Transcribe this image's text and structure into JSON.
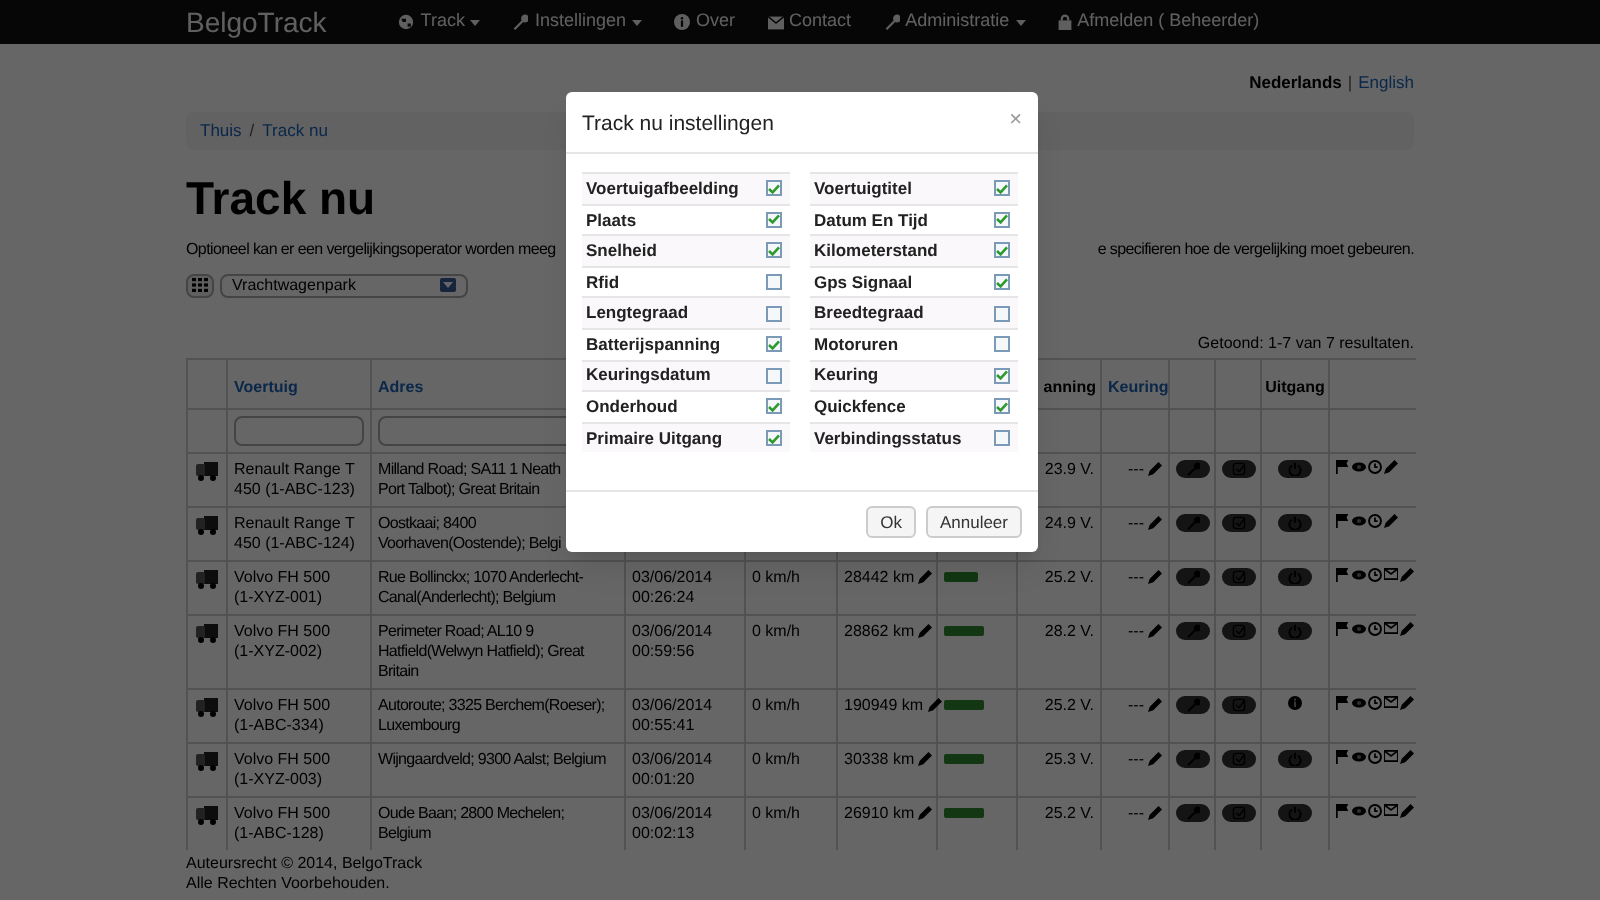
{
  "navbar": {
    "brand": "BelgoTrack",
    "items": [
      {
        "label": "Track",
        "dropdown": true
      },
      {
        "label": "Instellingen",
        "dropdown": true
      },
      {
        "label": "Over",
        "dropdown": false
      },
      {
        "label": "Contact",
        "dropdown": false
      },
      {
        "label": "Administratie",
        "dropdown": true
      },
      {
        "label": "Afmelden ( Beheerder)",
        "dropdown": false
      }
    ]
  },
  "languages": [
    {
      "label": "Nederlands",
      "selected": true
    },
    {
      "label": "English",
      "selected": false
    }
  ],
  "language_separator": "|",
  "breadcrumb": [
    "Thuis",
    "Track nu"
  ],
  "breadcrumb_separator": "/",
  "title": "Track nu",
  "intro": [
    "Optioneel kan er een vergelijkingsoperator worden meeg",
    "e specifieren hoe de vergelijking moet gebeuren."
  ],
  "fleet_select": {
    "value": "Vrachtwagenpark"
  },
  "summary": "Getoond: 1-7 van 7 resultaten.",
  "columns": {
    "vehicle": {
      "label": "Voertuig",
      "link": true
    },
    "address": {
      "label": "Adres",
      "link": true
    },
    "voltage": {
      "label": "anning",
      "link": false
    },
    "inspection": {
      "label": "Keuring",
      "link": true
    },
    "output": {
      "label": "Uitgang",
      "link": false
    }
  },
  "rows": [
    {
      "vehicle": "Renault Range T\n450 (1-ABC-123)",
      "address": "Milland Road; SA11 1 Neath\nPort Talbot); Great Britain",
      "voltage": "23.9 V.",
      "inspection": "---",
      "kind": "power",
      "mail": false
    },
    {
      "vehicle": "Renault Range T\n450 (1-ABC-124)",
      "address": "Oostkaai; 8400\nVoorhaven(Oostende); Belgi",
      "voltage": "24.9 V.",
      "inspection": "---",
      "kind": "power",
      "mail": false
    },
    {
      "vehicle": "Volvo FH 500\n(1-XYZ-001)",
      "address": "Rue Bollinckx; 1070 Anderlecht-\nCanal(Anderlecht); Belgium",
      "date": "03/06/2014\n00:26:24",
      "speed": "0 km/h",
      "odometer": "28442 km",
      "level": 0.5,
      "voltage": "25.2 V.",
      "inspection": "---",
      "kind": "power",
      "mail": true
    },
    {
      "vehicle": "Volvo FH 500\n(1-XYZ-002)",
      "address": "Perimeter Road; AL10 9\nHatfield(Welwyn Hatfield); Great\nBritain",
      "date": "03/06/2014\n00:59:56",
      "speed": "0 km/h",
      "odometer": "28862 km",
      "level": 0.58,
      "voltage": "28.2 V.",
      "inspection": "---",
      "kind": "power",
      "mail": true
    },
    {
      "vehicle": "Volvo FH 500\n(1-ABC-334)",
      "address": "Autoroute; 3325 Berchem(Roeser);\nLuxembourg",
      "date": "03/06/2014\n00:55:41",
      "speed": "0 km/h",
      "odometer": "190949 km",
      "level": 0.58,
      "voltage": "25.2 V.",
      "inspection": "---",
      "kind": "info",
      "mail": true
    },
    {
      "vehicle": "Volvo FH 500\n(1-XYZ-003)",
      "address": "Wijngaardveld; 9300 Aalst; Belgium",
      "date": "03/06/2014\n00:01:20",
      "speed": "0 km/h",
      "odometer": "30338 km",
      "level": 0.58,
      "voltage": "25.3 V.",
      "inspection": "---",
      "kind": "power",
      "mail": true
    },
    {
      "vehicle": "Volvo FH 500\n(1-ABC-128)",
      "address": "Oude Baan; 2800 Mechelen;\nBelgium",
      "date": "03/06/2014\n00:02:13",
      "speed": "0 km/h",
      "odometer": "26910 km",
      "level": 0.58,
      "voltage": "25.2 V.",
      "inspection": "---",
      "kind": "power",
      "mail": true
    }
  ],
  "footer": [
    "Auteursrecht © 2014, BelgoTrack",
    "Alle Rechten Voorbehouden."
  ],
  "modal": {
    "title": "Track nu instellingen",
    "close": "×",
    "left": [
      {
        "label": "Voertuigafbeelding",
        "checked": true
      },
      {
        "label": "Plaats",
        "checked": true
      },
      {
        "label": "Snelheid",
        "checked": true
      },
      {
        "label": "Rfid",
        "checked": false
      },
      {
        "label": "Lengtegraad",
        "checked": false
      },
      {
        "label": "Batterijspanning",
        "checked": true
      },
      {
        "label": "Keuringsdatum",
        "checked": false
      },
      {
        "label": "Onderhoud",
        "checked": true
      },
      {
        "label": "Primaire Uitgang",
        "checked": true
      }
    ],
    "right": [
      {
        "label": "Voertuigtitel",
        "checked": true
      },
      {
        "label": "Datum En Tijd",
        "checked": true
      },
      {
        "label": "Kilometerstand",
        "checked": true
      },
      {
        "label": "Gps Signaal",
        "checked": true
      },
      {
        "label": "Breedtegraad",
        "checked": false
      },
      {
        "label": "Motoruren",
        "checked": false
      },
      {
        "label": "Keuring",
        "checked": true
      },
      {
        "label": "Quickfence",
        "checked": true
      },
      {
        "label": "Verbindingsstatus",
        "checked": false
      }
    ],
    "buttons": [
      "Ok",
      "Annuleer"
    ]
  }
}
